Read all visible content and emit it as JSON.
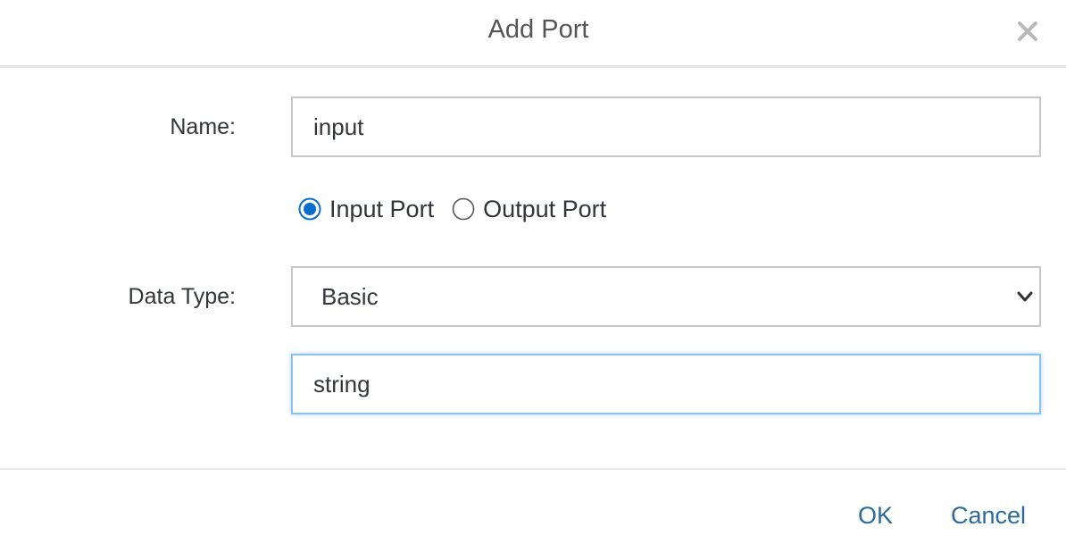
{
  "dialog": {
    "title": "Add Port",
    "close_icon": "close-icon"
  },
  "form": {
    "name_label": "Name:",
    "name_value": "input",
    "port_direction": {
      "options": [
        {
          "label": "Input Port",
          "selected": true
        },
        {
          "label": "Output Port",
          "selected": false
        }
      ]
    },
    "data_type_label": "Data Type:",
    "data_type_selected": "Basic",
    "data_type_value": "string"
  },
  "footer": {
    "ok_label": "OK",
    "cancel_label": "Cancel"
  },
  "colors": {
    "accent": "#0a6ed1",
    "link": "#2b6a9e",
    "focus_border": "#8cc4f0"
  }
}
